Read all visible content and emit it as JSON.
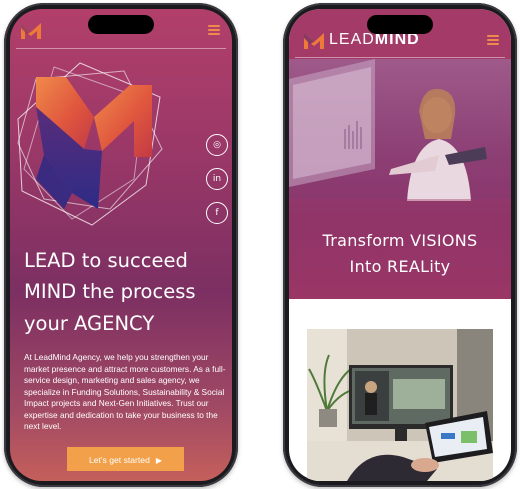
{
  "left_phone": {
    "header": {
      "logo_icon": "m-logo-icon",
      "menu_icon": "hamburger-menu-icon"
    },
    "social_links": [
      {
        "name": "instagram",
        "icon": "instagram-icon",
        "glyph": "◎"
      },
      {
        "name": "linkedin",
        "icon": "linkedin-icon",
        "glyph": "in"
      },
      {
        "name": "facebook",
        "icon": "facebook-icon",
        "glyph": "f"
      }
    ],
    "headline": {
      "line1_strong": "LEAD",
      "line1_rest": " to succeed",
      "line2_strong": "MIND",
      "line2_rest": " the process",
      "line3_rest": "your ",
      "line3_strong": "AGENCY"
    },
    "paragraph": "At LeadMind Agency, we help you strengthen your market presence and attract more customers. As a full-service design, marketing and sales agency, we specialize in Funding Solutions, Sustainability & Social Impact projects and Next-Gen Initiatives. Trust our expertise and dedication to take your business to the next level.",
    "cta_label": "Let's get started",
    "cta_arrow": "▶"
  },
  "right_phone": {
    "header": {
      "logo_icon": "m-logo-icon",
      "brand_regular": "LEAD",
      "brand_bold": "MIND",
      "menu_icon": "hamburger-menu-icon"
    },
    "hero_title_line1": "Transform VISIONS",
    "hero_title_line2": "Into REALity"
  },
  "colors": {
    "accent_orange": "#f2a14a",
    "brand_magenta": "#a33a68",
    "gradient_top": "#b23f6a",
    "gradient_bottom": "#c45f5b"
  }
}
